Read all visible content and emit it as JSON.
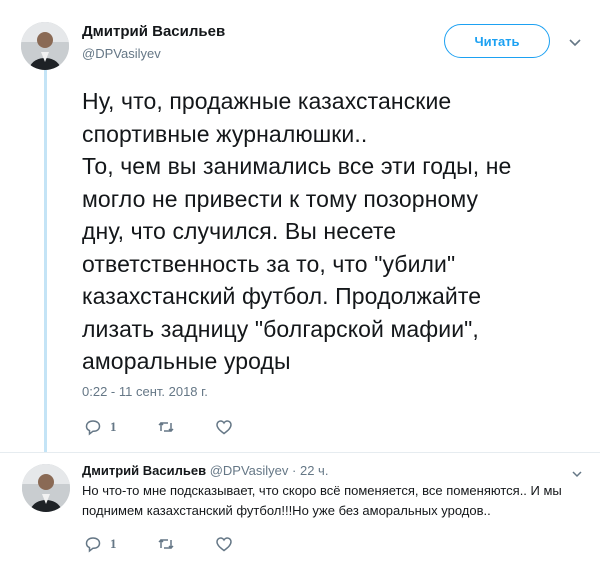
{
  "tweet": {
    "author_name": "Дмитрий Васильев",
    "author_handle": "@DPVasilyev",
    "follow_label": "Читать",
    "text": "Ну, что, продажные казахстанские\nспортивные журналюшки..\nТо, чем вы занимались все эти годы, не\nмогло не привести к тому позорному\nдну, что случился. Вы несете\nответственность за то, что \"убили\"\nказахстанский футбол. Продолжайте\nлизать задницу \"болгарской мафии\",\nаморальные уроды",
    "timestamp": "0:22 - 11 сент. 2018 г.",
    "reply_count": "1",
    "icons": [
      "reply-icon",
      "retweet-icon",
      "like-icon",
      "chevron-down-icon"
    ]
  },
  "reply": {
    "author_name": "Дмитрий Васильев",
    "author_meta": "@DPVasilyev · 22 ч.",
    "text": "Но что-то мне подсказывает, что скоро всё поменяется, все поменяются.. И мы поднимем казахстанский футбол!!!Но уже без аморальных уродов..",
    "reply_count": "1"
  },
  "colors": {
    "accent": "#1da1f2",
    "thread_line": "#c4e4f6",
    "secondary_text": "#657786",
    "primary_text": "#14171a"
  }
}
